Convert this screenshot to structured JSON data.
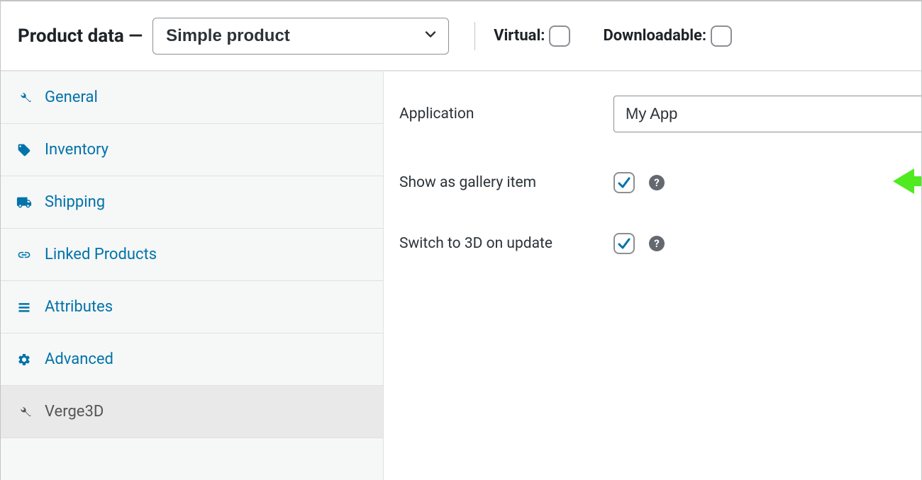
{
  "header": {
    "title": "Product data —",
    "product_type": {
      "selected": "Simple product"
    },
    "virtual": {
      "label": "Virtual:",
      "checked": false
    },
    "downloadable": {
      "label": "Downloadable:",
      "checked": false
    }
  },
  "tabs": [
    {
      "id": "general",
      "label": "General",
      "icon": "wrench"
    },
    {
      "id": "inventory",
      "label": "Inventory",
      "icon": "tag"
    },
    {
      "id": "shipping",
      "label": "Shipping",
      "icon": "truck"
    },
    {
      "id": "linked",
      "label": "Linked Products",
      "icon": "link"
    },
    {
      "id": "attributes",
      "label": "Attributes",
      "icon": "list"
    },
    {
      "id": "advanced",
      "label": "Advanced",
      "icon": "gear"
    },
    {
      "id": "verge3d",
      "label": "Verge3D",
      "icon": "wrench",
      "active": true
    }
  ],
  "content": {
    "application": {
      "label": "Application",
      "value": "My App"
    },
    "show_gallery": {
      "label": "Show as gallery item",
      "checked": true
    },
    "switch_3d": {
      "label": "Switch to 3D on update",
      "checked": true
    }
  },
  "icons": {
    "help_glyph": "?"
  },
  "annotation": {
    "arrow_color": "#4fea1f"
  }
}
